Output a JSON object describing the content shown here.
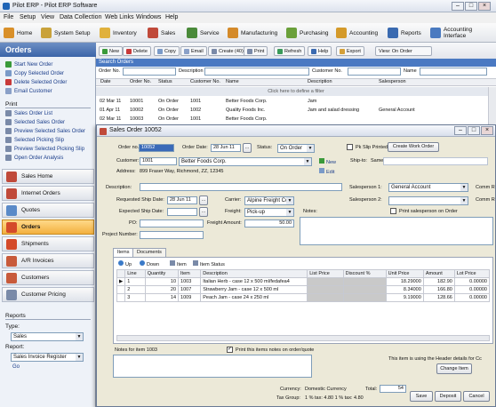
{
  "window": {
    "title": "Pilot ERP - Pilot ERP Software"
  },
  "menu": [
    "File",
    "Setup",
    "View",
    "Data Collection",
    "Web Links",
    "Windows",
    "Help"
  ],
  "toolbar": [
    "Home",
    "System Setup",
    "Inventory",
    "Sales",
    "Service",
    "Manufacturing",
    "Purchasing",
    "Accounting",
    "Reports",
    "Accounting Interface"
  ],
  "sidebar": {
    "title": "Orders",
    "tasks": [
      "Start New Order",
      "Copy Selected Order",
      "Delete Selected Order",
      "Email Customer"
    ],
    "print_label": "Print",
    "print_items": [
      "Sales Order List",
      "Selected Sales Order",
      "Preview Selected Sales Order",
      "Selected Picking Slip",
      "Preview Selected Picking Slip",
      "Open Order Analysis"
    ],
    "nav": [
      "Sales Home",
      "Internet Orders",
      "Quotes",
      "Orders",
      "Shipments",
      "A/R Invoices",
      "Customers",
      "Customer Pricing"
    ],
    "reports_label": "Reports",
    "type_label": "Type:",
    "type_value": "Sales",
    "report_label": "Report:",
    "report_value": "Sales Invoice Register",
    "go": "Go"
  },
  "main": {
    "buttons": [
      "New",
      "Delete",
      "Copy",
      "Email",
      "Create (40)",
      "Print",
      "Refresh",
      "Help",
      "Export",
      "View: On Order"
    ],
    "search_title": "Search Orders",
    "search_labels": [
      "Order No.",
      "Description",
      "Customer No.",
      "Name"
    ],
    "columns": [
      "Date",
      "Order No.",
      "Status",
      "Customer No.",
      "Name",
      "Description",
      "Salesperson"
    ],
    "filter_hint": "Click here to define a filter",
    "rows": [
      [
        "02 Mar 11",
        "10001",
        "On Order",
        "1001",
        "Better Foods Corp.",
        "Jam",
        ""
      ],
      [
        "01 Apr 11",
        "10002",
        "On Order",
        "1002",
        "Quality Foods Inc.",
        "Jam and salad dressing",
        "General Account"
      ],
      [
        "02 Mar 11",
        "10003",
        "On Order",
        "1001",
        "Better Foods Corp.",
        "",
        ""
      ]
    ]
  },
  "dialog": {
    "title": "Sales Order 10052",
    "order_no_label": "Order no.:",
    "order_no": "10052",
    "order_date_label": "Order Date:",
    "order_date": "28 Jun 11",
    "status_label": "Status:",
    "status": "On Order",
    "pk_slip_label": "Pk Slip Printed",
    "create_work_order": "Create Work Order",
    "customer_label": "Customer:",
    "customer_no": "1001",
    "customer_name": "Better Foods Corp.",
    "new_link": "New",
    "edit_link": "Edit",
    "ship_to_label": "Ship-to:",
    "ship_to": "Same",
    "address_label": "Address:",
    "address": "899 Fraser Way, Richmond, ZZ, 12345",
    "description_label": "Description:",
    "salesperson1_label": "Salesperson 1:",
    "salesperson1": "General Account",
    "salesperson2_label": "Salesperson 2:",
    "comm_label": "Comm R",
    "req_ship_label": "Requested Ship Date:",
    "req_ship": "28 Jun 11",
    "carrier_label": "Carrier:",
    "carrier": "Alpine Freight Co.",
    "exp_ship_label": "Expected Ship Date:",
    "freight_label": "Freight:",
    "freight": "Pick-up",
    "notes_label": "Notes:",
    "print_sp_label": "Print salesperson on Order",
    "po_label": "PO:",
    "freight_amt_label": "Freight Amount:",
    "freight_amt": "50.00",
    "project_label": "Project Number:",
    "tabs": [
      "Items",
      "Documents"
    ],
    "item_buttons": [
      "Up",
      "Down",
      "Item",
      "Item Status"
    ],
    "columns": [
      "Line",
      "Quantity",
      "Item",
      "Description",
      "List Price",
      "Discount %",
      "Unit Price",
      "Amount",
      "Lot Price"
    ],
    "items": [
      [
        "1",
        "10",
        "1003",
        "Italian Herb - case 12 x 500 ml/fedafea4",
        "",
        "",
        "18.29000",
        "182.90",
        "0.00000"
      ],
      [
        "2",
        "20",
        "1007",
        "Strawberry Jam - case 12 x 500 ml",
        "",
        "",
        "8.34000",
        "166.80",
        "0.00000"
      ],
      [
        "3",
        "14",
        "1009",
        "Peach Jam - case 24 x 250 ml",
        "",
        "",
        "9.19000",
        "128.66",
        "0.00000"
      ]
    ],
    "notes_item_label": "Notes for item 1003",
    "print_notes_label": "Print this items notes on order/quote",
    "header_detail_text": "This item is using the Header details for Cc",
    "change_item": "Change Item",
    "currency_label": "Currency:",
    "currency": "Domestic Currency",
    "total_label": "Total:",
    "total": "54",
    "tax_group_label": "Tax Group:",
    "tax_group": "1 % tax: 4.80   1 % tax: 4.80",
    "save": "Save",
    "deposit": "Deposit",
    "cancel": "Cancel"
  },
  "colors": {
    "nav_active": "#f3b03f",
    "header_blue": "#3b64a8",
    "search_blue": "#4a79c2"
  }
}
